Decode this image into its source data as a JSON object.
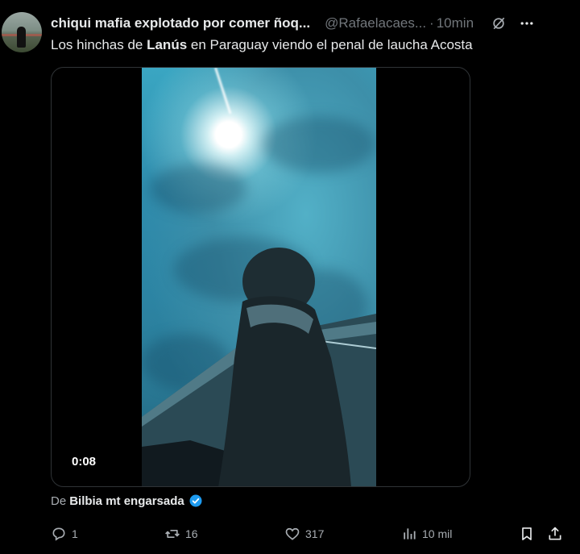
{
  "post": {
    "author_name": "chiqui mafia explotado por comer ñoq...",
    "handle": "@Rafaelacaes...",
    "separator": "·",
    "time": "10min",
    "text_before": "Los hinchas de ",
    "text_bold": "Lanús",
    "text_after": " en Paraguay viendo el penal de laucha Acosta"
  },
  "media": {
    "duration": "0:08"
  },
  "source": {
    "prefix": "De",
    "name": "Bilbia mt engarsada"
  },
  "actions": {
    "replies": "1",
    "reposts": "16",
    "likes": "317",
    "views": "10 mil"
  },
  "colors": {
    "background": "#000000",
    "text": "#e7e9ea",
    "secondary": "#71767b",
    "verified": "#1d9bf0",
    "border": "#2f3336"
  },
  "icons": [
    "grok-icon",
    "more-icon",
    "reply-icon",
    "repost-icon",
    "like-icon",
    "views-icon",
    "bookmark-icon",
    "share-icon",
    "verified-badge-icon"
  ]
}
